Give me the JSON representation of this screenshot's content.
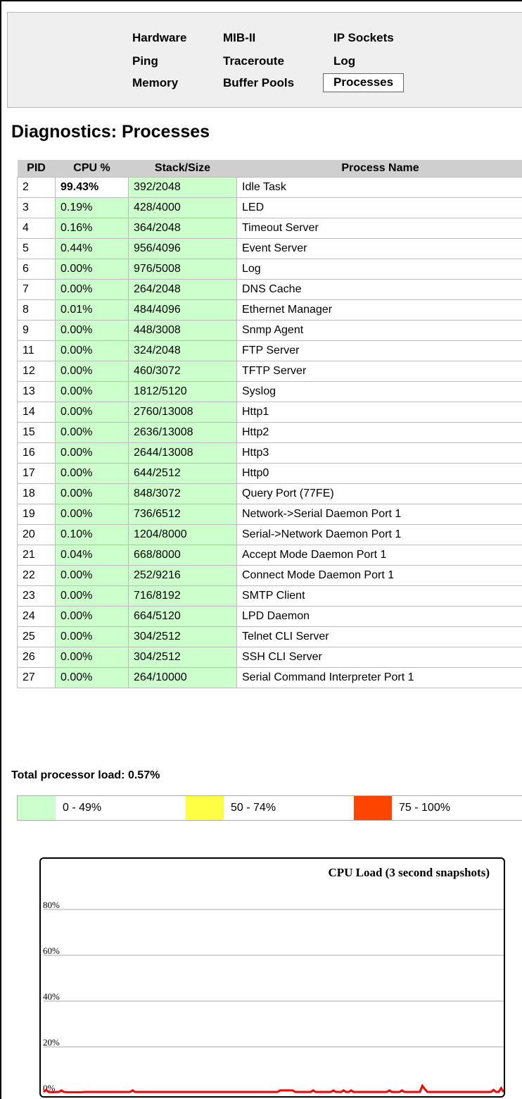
{
  "nav": {
    "items": [
      {
        "label": "Hardware",
        "selected": false
      },
      {
        "label": "MIB-II",
        "selected": false
      },
      {
        "label": "IP Sockets",
        "selected": false
      },
      {
        "label": "Ping",
        "selected": false
      },
      {
        "label": "Traceroute",
        "selected": false
      },
      {
        "label": "Log",
        "selected": false
      },
      {
        "label": "Memory",
        "selected": false
      },
      {
        "label": "Buffer Pools",
        "selected": false
      },
      {
        "label": "Processes",
        "selected": true
      }
    ]
  },
  "page_title": "Diagnostics: Processes",
  "table": {
    "headers": [
      "PID",
      "CPU %",
      "Stack/Size",
      "Process Name"
    ],
    "rows": [
      {
        "pid": "2",
        "cpu": "99.43%",
        "stack": "392/2048",
        "name": "Idle Task"
      },
      {
        "pid": "3",
        "cpu": "0.19%",
        "stack": "428/4000",
        "name": "LED"
      },
      {
        "pid": "4",
        "cpu": "0.16%",
        "stack": "364/2048",
        "name": "Timeout Server"
      },
      {
        "pid": "5",
        "cpu": "0.44%",
        "stack": "956/4096",
        "name": "Event Server"
      },
      {
        "pid": "6",
        "cpu": "0.00%",
        "stack": "976/5008",
        "name": "Log"
      },
      {
        "pid": "7",
        "cpu": "0.00%",
        "stack": "264/2048",
        "name": "DNS Cache"
      },
      {
        "pid": "8",
        "cpu": "0.01%",
        "stack": "484/4096",
        "name": "Ethernet Manager"
      },
      {
        "pid": "9",
        "cpu": "0.00%",
        "stack": "448/3008",
        "name": "Snmp Agent"
      },
      {
        "pid": "11",
        "cpu": "0.00%",
        "stack": "324/2048",
        "name": "FTP Server"
      },
      {
        "pid": "12",
        "cpu": "0.00%",
        "stack": "460/3072",
        "name": "TFTP Server"
      },
      {
        "pid": "13",
        "cpu": "0.00%",
        "stack": "1812/5120",
        "name": "Syslog"
      },
      {
        "pid": "14",
        "cpu": "0.00%",
        "stack": "2760/13008",
        "name": "Http1"
      },
      {
        "pid": "15",
        "cpu": "0.00%",
        "stack": "2636/13008",
        "name": "Http2"
      },
      {
        "pid": "16",
        "cpu": "0.00%",
        "stack": "2644/13008",
        "name": "Http3"
      },
      {
        "pid": "17",
        "cpu": "0.00%",
        "stack": "644/2512",
        "name": "Http0"
      },
      {
        "pid": "18",
        "cpu": "0.00%",
        "stack": "848/3072",
        "name": "Query Port (77FE)"
      },
      {
        "pid": "19",
        "cpu": "0.00%",
        "stack": "736/6512",
        "name": "Network->Serial Daemon Port 1"
      },
      {
        "pid": "20",
        "cpu": "0.10%",
        "stack": "1204/8000",
        "name": "Serial->Network Daemon Port 1"
      },
      {
        "pid": "21",
        "cpu": "0.04%",
        "stack": "668/8000",
        "name": "Accept Mode Daemon Port 1"
      },
      {
        "pid": "22",
        "cpu": "0.00%",
        "stack": "252/9216",
        "name": "Connect Mode Daemon Port 1"
      },
      {
        "pid": "23",
        "cpu": "0.00%",
        "stack": "716/8192",
        "name": "SMTP Client"
      },
      {
        "pid": "24",
        "cpu": "0.00%",
        "stack": "664/5120",
        "name": "LPD Daemon"
      },
      {
        "pid": "25",
        "cpu": "0.00%",
        "stack": "304/2512",
        "name": "Telnet CLI Server"
      },
      {
        "pid": "26",
        "cpu": "0.00%",
        "stack": "304/2512",
        "name": "SSH CLI Server"
      },
      {
        "pid": "27",
        "cpu": "0.00%",
        "stack": "264/10000",
        "name": "Serial Command Interpreter Port 1"
      }
    ]
  },
  "total_load": "Total processor load: 0.57%",
  "legend": [
    {
      "label": "0 - 49%",
      "color": "#ccffcc"
    },
    {
      "label": "50 - 74%",
      "color": "#ffff44"
    },
    {
      "label": "75 - 100%",
      "color": "#ff4400"
    }
  ],
  "chart_data": {
    "type": "line",
    "title": "CPU Load (3 second snapshots)",
    "ytick_labels": [
      "80%",
      "60%",
      "40%",
      "20%",
      "0%"
    ],
    "yticks": [
      80,
      60,
      40,
      20,
      0
    ],
    "ylim": [
      0,
      100
    ],
    "grid": true,
    "line_color": "#ff0000",
    "series": [
      {
        "values": [
          0.3,
          1.2,
          0.3,
          0.2,
          0.2,
          0.3,
          0.3,
          1.0,
          0.3,
          0.2,
          0.2,
          0.2,
          0.2,
          0.2,
          0.2,
          0.2,
          0.3,
          0.3,
          0.3,
          0.3,
          0.3,
          0.3,
          0.3,
          0.3,
          0.3,
          0.3,
          0.3,
          0.3,
          0.3,
          0.3,
          0.3,
          0.3,
          0.3,
          0.3,
          0.3,
          1.0,
          0.3,
          0.3,
          0.3,
          0.3,
          0.3,
          0.3,
          0.3,
          0.3,
          0.3,
          0.3,
          0.3,
          0.3,
          0.3,
          0.3,
          0.3,
          0.3,
          0.3,
          0.3,
          0.3,
          0.3,
          0.3,
          0.3,
          0.3,
          0.3,
          0.3,
          0.3,
          0.3,
          0.3,
          0.3,
          0.3,
          0.3,
          0.3,
          0.3,
          0.3,
          0.3,
          0.3,
          0.3,
          0.3,
          0.3,
          0.3,
          0.3,
          0.3,
          0.3,
          0.3,
          0.3,
          0.3,
          0.3,
          0.3,
          0.3,
          0.3,
          0.3,
          0.3,
          0.3,
          0.3,
          0.3,
          0.3,
          0.3,
          1.0,
          1.0,
          1.0,
          1.0,
          1.0,
          1.0,
          0.3,
          0.3,
          0.3,
          0.3,
          0.3,
          0.3,
          0.3,
          1.0,
          0.3,
          0.3,
          0.3,
          0.3,
          0.3,
          0.3,
          0.3,
          1.0,
          0.3,
          0.3,
          0.3,
          1.0,
          0.3,
          0.3,
          1.0,
          0.3,
          0.3,
          0.3,
          0.3,
          0.3,
          0.3,
          0.3,
          0.3,
          0.3,
          0.3,
          0.3,
          0.3,
          0.3,
          0.3,
          1.0,
          0.3,
          0.3,
          0.3,
          0.3,
          1.0,
          0.3,
          0.3,
          0.3,
          0.3,
          0.3,
          0.3,
          0.3,
          3.0,
          1.5,
          0.3,
          0.3,
          0.3,
          0.3,
          0.3,
          0.3,
          0.3,
          0.3,
          0.3,
          0.3,
          0.3,
          0.3,
          0.3,
          0.3,
          0.3,
          0.3,
          0.3,
          0.3,
          0.3,
          0.3,
          0.3,
          0.3,
          0.3,
          0.3,
          0.3,
          0.3,
          1.2,
          0.3,
          0.3,
          2.0,
          0.3
        ]
      }
    ]
  }
}
